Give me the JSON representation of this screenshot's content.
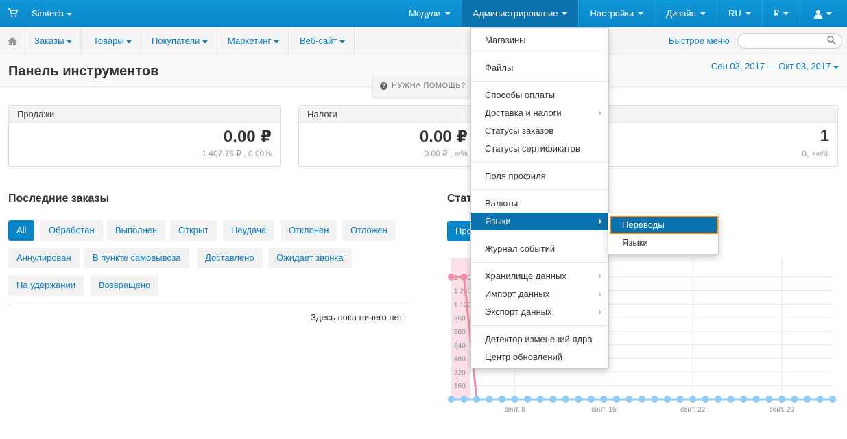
{
  "topbar": {
    "brand": "Simtech",
    "nav": [
      {
        "label": "Модули",
        "name": "modules"
      },
      {
        "label": "Администрирование",
        "name": "administration"
      },
      {
        "label": "Настройки",
        "name": "settings"
      },
      {
        "label": "Дизайн",
        "name": "design"
      },
      {
        "label": "RU",
        "name": "language"
      },
      {
        "label": "₽",
        "name": "currency"
      }
    ]
  },
  "subnav": {
    "items": [
      "Заказы",
      "Товары",
      "Покупатели",
      "Маркетинг",
      "Веб-сайт"
    ],
    "quick_menu": "Быстрое меню",
    "search_placeholder": ""
  },
  "header": {
    "title": "Панель инструментов",
    "date_range": "Сен 03, 2017 — Окт 03, 2017",
    "help": "НУЖНА ПОМОЩЬ?"
  },
  "cards": [
    {
      "title": "Продажи",
      "value": "0.00 ₽",
      "sub": "1 407.75 ₽ , 0.00%"
    },
    {
      "title": "Налоги",
      "value": "0.00 ₽",
      "sub": "0.00 ₽ , ∞%"
    },
    {
      "title": "",
      "value": "1",
      "sub": "0, +∞%"
    }
  ],
  "orders": {
    "title": "Последние заказы",
    "filters": [
      "All",
      "Обработан",
      "Выполнен",
      "Открыт",
      "Неудача",
      "Отклонен",
      "Отложен",
      "Аннулирован",
      "В пункте самовывоза",
      "Доставлено",
      "Ожидает звонка",
      "На удержании",
      "Возвращено"
    ],
    "active_filter": "All",
    "empty": "Здесь пока ничего нет"
  },
  "stats": {
    "title": "Стат",
    "tab": "Про"
  },
  "chart_data": {
    "type": "line",
    "y_ticks": [
      "1 440",
      "1 280",
      "1 120",
      "960",
      "800",
      "640",
      "480",
      "320",
      "160"
    ],
    "x_ticks": [
      "сент. 8",
      "сент. 15",
      "сент. 22",
      "сент. 29"
    ],
    "series": [
      {
        "color": "#f28fa6",
        "values": [
          1440,
          1440,
          0,
          0,
          0,
          0,
          0,
          0,
          0,
          0,
          0,
          0,
          0,
          0,
          0,
          0,
          0,
          0,
          0,
          0,
          0,
          0,
          0,
          0,
          0,
          0,
          0,
          0,
          0,
          0,
          0
        ]
      },
      {
        "color": "#8fcdf5",
        "values": [
          0,
          0,
          0,
          0,
          0,
          0,
          0,
          0,
          0,
          0,
          0,
          0,
          0,
          0,
          0,
          0,
          0,
          0,
          0,
          0,
          0,
          0,
          0,
          0,
          0,
          0,
          0,
          0,
          0,
          0,
          0
        ]
      }
    ]
  },
  "admin_menu": {
    "groups": [
      [
        {
          "label": "Магазины"
        }
      ],
      [
        {
          "label": "Файлы"
        }
      ],
      [
        {
          "label": "Способы оплаты"
        },
        {
          "label": "Доставка и налоги",
          "sub": true
        },
        {
          "label": "Статусы заказов"
        },
        {
          "label": "Статусы сертификатов"
        }
      ],
      [
        {
          "label": "Поля профиля"
        }
      ],
      [
        {
          "label": "Валюты"
        },
        {
          "label": "Языки",
          "sub": true,
          "hover": true
        }
      ],
      [
        {
          "label": "Журнал событий"
        }
      ],
      [
        {
          "label": "Хранилище данных",
          "sub": true
        },
        {
          "label": "Импорт данных",
          "sub": true
        },
        {
          "label": "Экспорт данных",
          "sub": true
        }
      ],
      [
        {
          "label": "Детектор изменений ядра"
        },
        {
          "label": "Центр обновлений"
        }
      ]
    ]
  },
  "languages_submenu": [
    "Переводы",
    "Языки"
  ]
}
